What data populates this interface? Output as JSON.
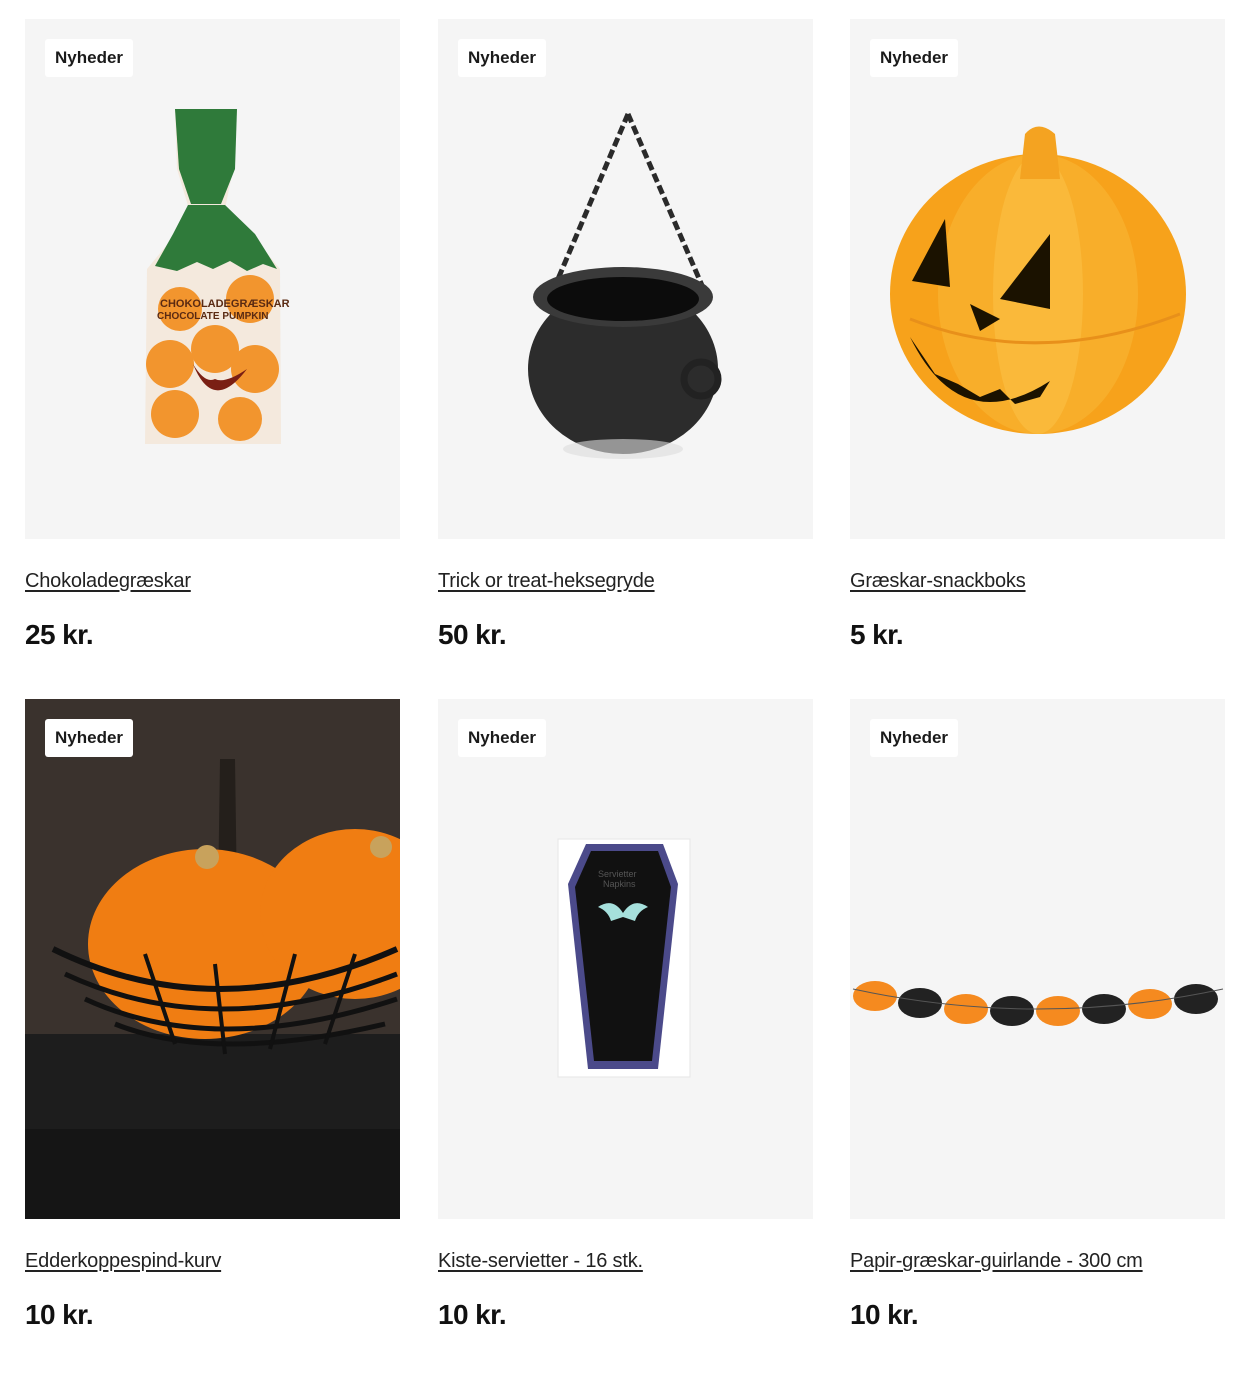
{
  "products": [
    {
      "badge": "Nyheder",
      "title": "Chokoladegræskar",
      "price": "25 kr.",
      "icon": "chocolate-pumpkin-bag-image"
    },
    {
      "badge": "Nyheder",
      "title": "Trick or treat-heksegryde",
      "price": "50 kr.",
      "icon": "cauldron-image"
    },
    {
      "badge": "Nyheder",
      "title": "Græskar-snackboks",
      "price": "5 kr.",
      "icon": "pumpkin-box-image"
    },
    {
      "badge": "Nyheder",
      "title": "Edderkoppespind-kurv",
      "price": "10 kr.",
      "icon": "spiderweb-basket-image"
    },
    {
      "badge": "Nyheder",
      "title": "Kiste-servietter - 16 stk.",
      "price": "10 kr.",
      "icon": "coffin-napkins-image"
    },
    {
      "badge": "Nyheder",
      "title": "Papir-græskar-guirlande - 300 cm",
      "price": "10 kr.",
      "icon": "pumpkin-garland-image"
    }
  ],
  "colors": {
    "tile_bg": "#f5f5f5",
    "pumpkin_orange": "#f7a21b",
    "dark": "#1a1a1a"
  }
}
